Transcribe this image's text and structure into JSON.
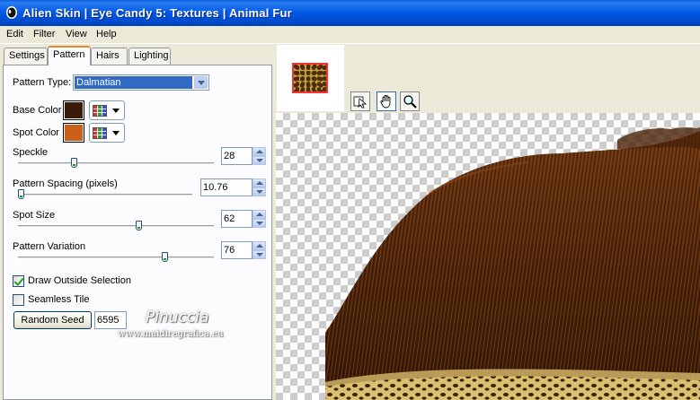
{
  "window": {
    "title": "Alien Skin | Eye Candy 5: Textures | Animal Fur"
  },
  "menu": [
    "Edit",
    "Filter",
    "View",
    "Help"
  ],
  "tabs": [
    "Settings",
    "Pattern",
    "Hairs",
    "Lighting"
  ],
  "active_tab": "Pattern",
  "pattern": {
    "type_label": "Pattern Type:",
    "type_value": "Dalmatian",
    "base_color_label": "Base Color",
    "base_color": "#3a1a08",
    "spot_color_label": "Spot Color",
    "spot_color": "#c8601a",
    "sliders": [
      {
        "label": "Speckle",
        "value": "28",
        "fraction": 0.28
      },
      {
        "label": "Pattern Spacing (pixels)",
        "value": "10.76",
        "fraction": 0.0
      },
      {
        "label": "Spot Size",
        "value": "62",
        "fraction": 0.62
      },
      {
        "label": "Pattern Variation",
        "value": "76",
        "fraction": 0.76
      }
    ],
    "draw_outside_label": "Draw Outside Selection",
    "draw_outside_checked": true,
    "seamless_label": "Seamless Tile",
    "seamless_checked": false,
    "random_seed_label": "Random Seed",
    "seed_value": "6595"
  },
  "watermark": {
    "name": "Pinuccia",
    "url": "www.maidiregrafica.eu"
  },
  "tools": [
    "preview-select-icon",
    "hand-icon",
    "zoom-icon"
  ],
  "colors": {
    "titlebar": "#0058e6",
    "selection": "#316ac5",
    "tab_accent": "#e68b2c"
  }
}
